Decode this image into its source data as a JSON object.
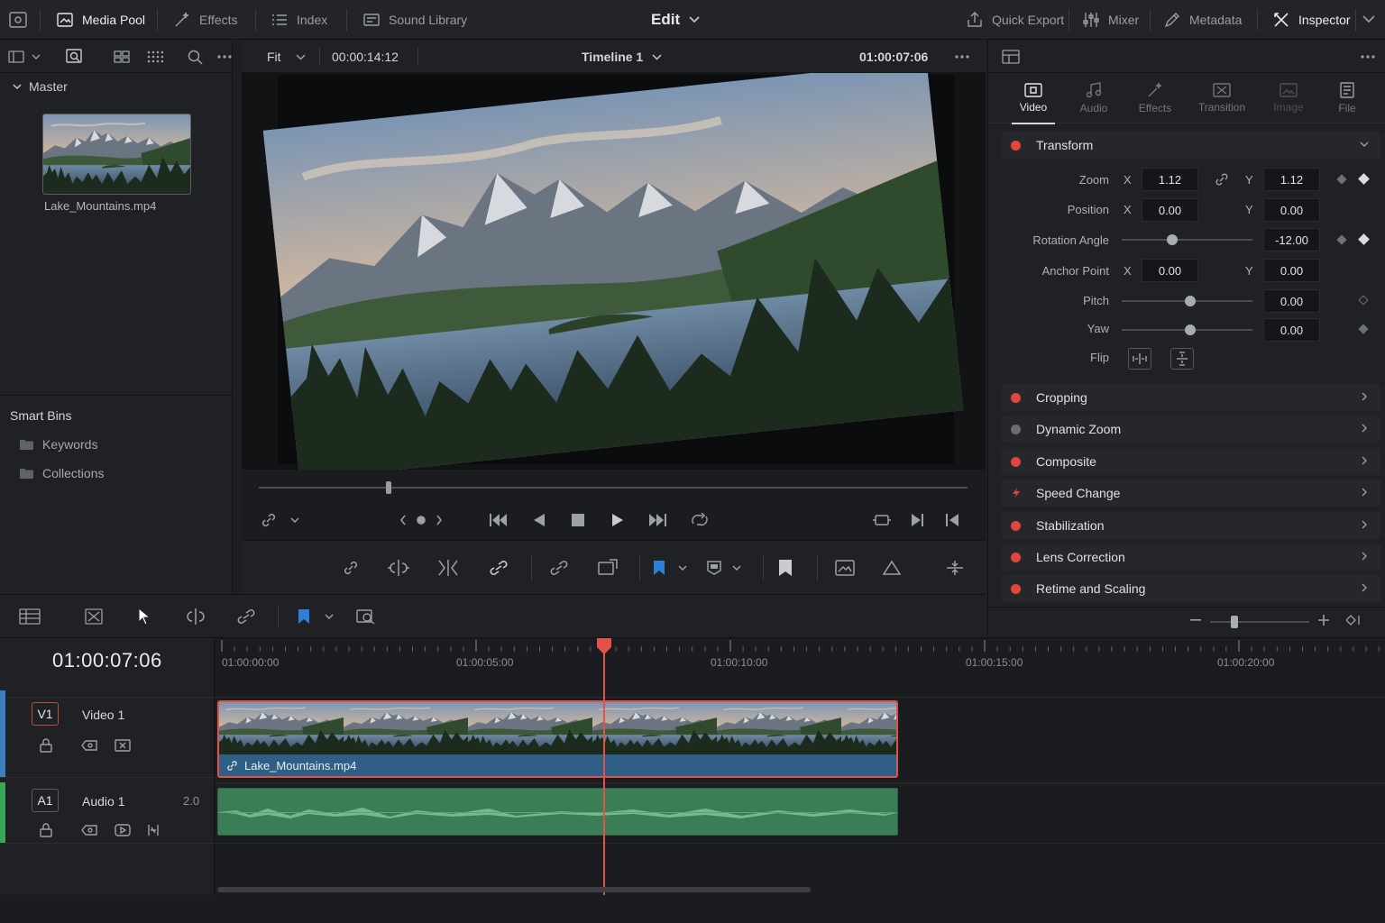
{
  "topbar": {
    "media_pool": "Media Pool",
    "effects": "Effects",
    "index": "Index",
    "sound_library": "Sound Library",
    "page": "Edit",
    "quick_export": "Quick Export",
    "mixer": "Mixer",
    "metadata": "Metadata",
    "inspector": "Inspector"
  },
  "media_pool": {
    "bin": "Master",
    "clip_name": "Lake_Mountains.mp4",
    "smart_bins_title": "Smart Bins",
    "smart_bins": [
      "Keywords",
      "Collections"
    ]
  },
  "viewer": {
    "zoom": "Fit",
    "duration": "00:00:14:12",
    "timeline_name": "Timeline 1",
    "timecode": "01:00:07:06",
    "playhead_fraction": 0.18
  },
  "inspector": {
    "tabs": [
      "Video",
      "Audio",
      "Effects",
      "Transition",
      "Image",
      "File"
    ],
    "active_tab": "Video",
    "transform_title": "Transform",
    "zoom_label": "Zoom",
    "zoom_x": "1.12",
    "zoom_y": "1.12",
    "position_label": "Position",
    "position_x": "0.00",
    "position_y": "0.00",
    "rotation_label": "Rotation Angle",
    "rotation_value": "-12.00",
    "anchor_label": "Anchor Point",
    "anchor_x": "0.00",
    "anchor_y": "0.00",
    "pitch_label": "Pitch",
    "pitch_value": "0.00",
    "yaw_label": "Yaw",
    "yaw_value": "0.00",
    "flip_label": "Flip",
    "axis_x": "X",
    "axis_y": "Y",
    "sections": [
      "Cropping",
      "Dynamic Zoom",
      "Composite",
      "Speed Change",
      "Stabilization",
      "Lens Correction",
      "Retime and Scaling"
    ]
  },
  "timeline": {
    "timecode": "01:00:07:06",
    "ruler": [
      "01:00:00:00",
      "01:00:05:00",
      "01:00:10:00",
      "01:00:15:00",
      "01:00:20:00"
    ],
    "video_track_id": "V1",
    "video_track_name": "Video 1",
    "audio_track_id": "A1",
    "audio_track_name": "Audio 1",
    "audio_channels": "2.0",
    "clip_name": "Lake_Mountains.mp4"
  },
  "colors": {
    "accent_red": "#e2524b",
    "video_clip": "#2f5f86",
    "audio_clip": "#3b7d55",
    "flag_blue": "#2f7fd6"
  }
}
